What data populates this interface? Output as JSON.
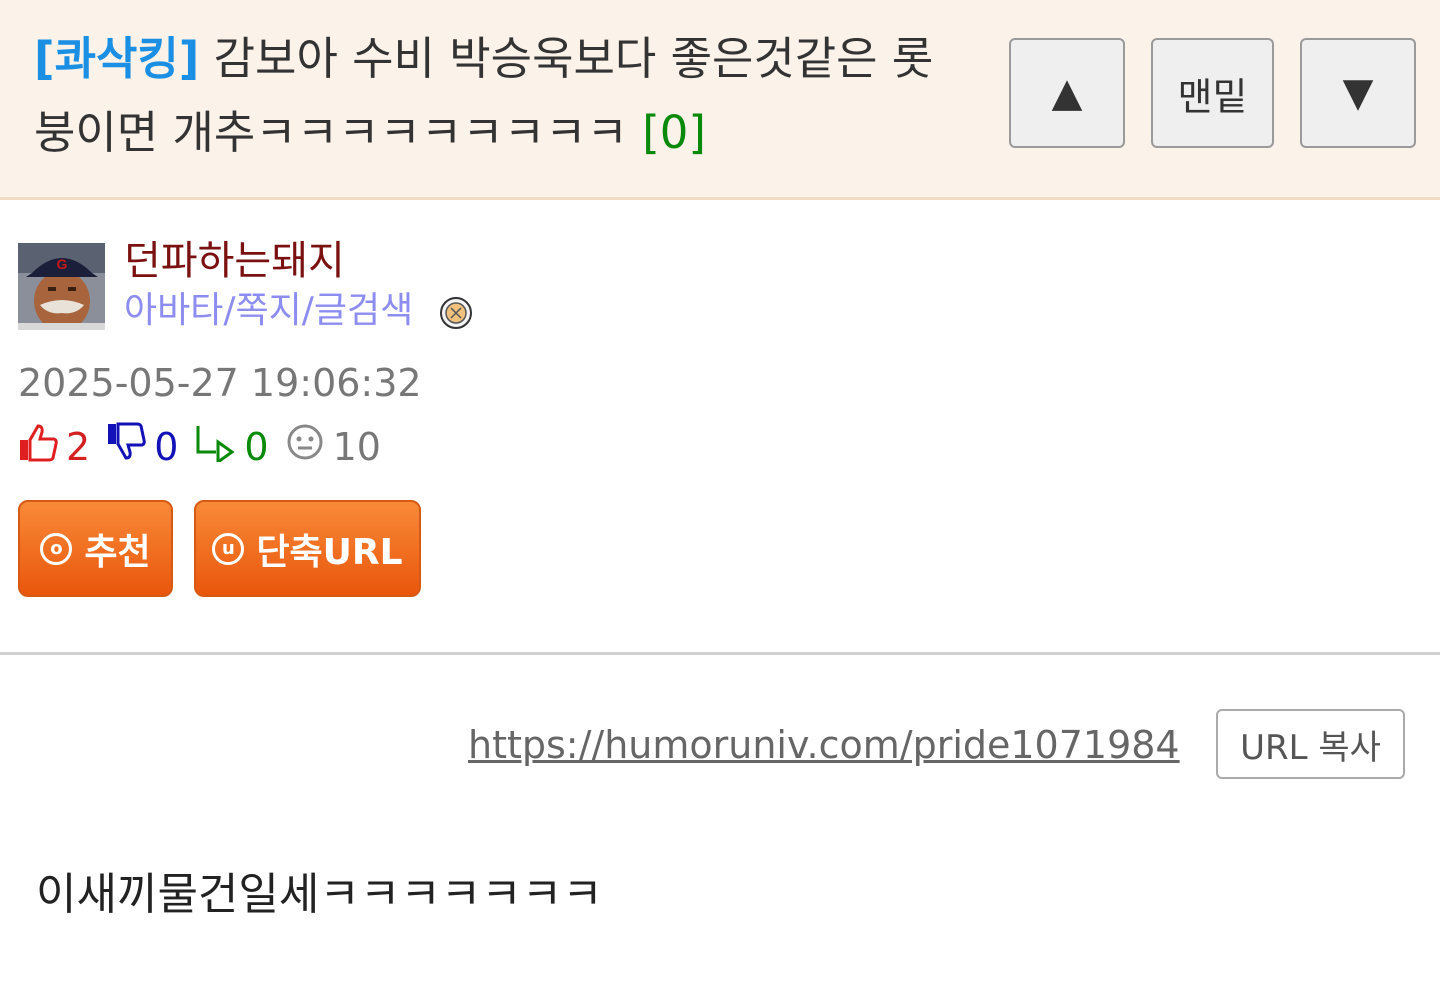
{
  "post": {
    "category": "[콰삭킹]",
    "title": "감보아 수비 박승욱보다 좋은것같은 롯붕이면 개추ㅋㅋㅋㅋㅋㅋㅋㅋㅋ",
    "comment_count": "[0]"
  },
  "nav": {
    "up_label": "▲",
    "bottom_label": "맨밑",
    "down_label": "▼"
  },
  "author": {
    "nickname": "던파하는돼지",
    "links": "아바타/쪽지/글검색"
  },
  "meta": {
    "date": "2025-05-27 19:06:32",
    "upvotes": "2",
    "downvotes": "0",
    "replies": "0",
    "views": "10"
  },
  "actions": {
    "recommend_label": "추천",
    "recommend_icon": "o",
    "shorturl_label": "단축URL",
    "shorturl_icon": "u"
  },
  "link": {
    "url": "https://humoruniv.com/pride1071984",
    "copy_label": "URL 복사"
  },
  "body": {
    "text": "이새끼물건일세ㅋㅋㅋㅋㅋㅋㅋ"
  },
  "colors": {
    "header_bg": "#fbf2ea",
    "category": "#1a8fe3",
    "comment_count": "#0a8a0a",
    "nickname": "#7a1010",
    "links": "#8d8df0",
    "accent_orange": "#f0640e"
  }
}
